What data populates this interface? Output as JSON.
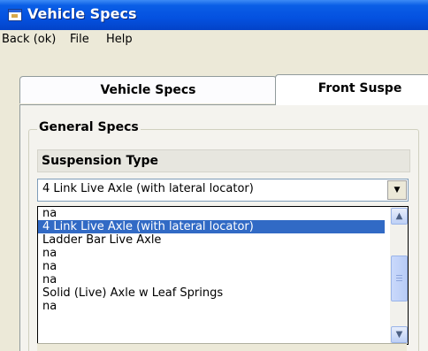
{
  "window": {
    "title": "Vehicle Specs"
  },
  "menu": {
    "items": [
      "Back (ok)",
      "File",
      "Help"
    ]
  },
  "tabs": [
    {
      "label": "Vehicle Specs"
    },
    {
      "label": "Front Suspe"
    }
  ],
  "group": {
    "label": "General Specs"
  },
  "suspension": {
    "label": "Suspension Type",
    "selected": "4 Link Live Axle (with lateral locator)",
    "options": [
      "na",
      "4 Link Live Axle (with lateral locator)",
      "Ladder Bar Live Axle",
      "na",
      "na",
      "na",
      "Solid (Live) Axle w Leaf Springs",
      "na"
    ],
    "highlighted_index": 1
  },
  "colors": {
    "title_bar": "#0451e0",
    "selection": "#316ac5",
    "window_bg": "#ece9d8"
  },
  "icons": {
    "app": "window-app-icon",
    "dropdown": "chevron-down-icon",
    "scroll_up": "chevron-up-icon",
    "scroll_down": "chevron-down-icon"
  }
}
